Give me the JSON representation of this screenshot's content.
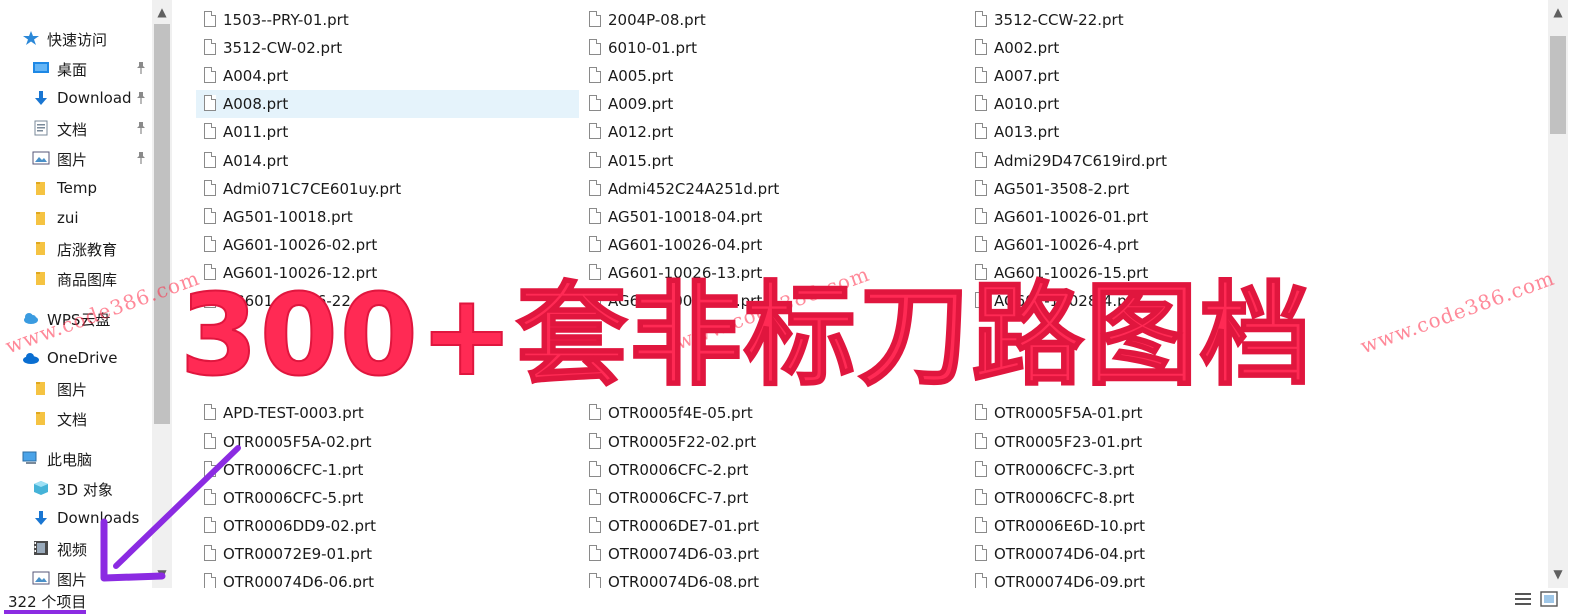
{
  "sidebar": {
    "items": [
      {
        "label": "快速访问",
        "icon": "star-icon",
        "pinned": false
      },
      {
        "label": "桌面",
        "icon": "desktop-icon",
        "pinned": true
      },
      {
        "label": "Download",
        "icon": "download-arrow-icon",
        "pinned": true
      },
      {
        "label": "文档",
        "icon": "document-icon",
        "pinned": true
      },
      {
        "label": "图片",
        "icon": "pictures-icon",
        "pinned": true
      },
      {
        "label": "Temp",
        "icon": "folder-icon",
        "pinned": false
      },
      {
        "label": "zui",
        "icon": "folder-icon",
        "pinned": false
      },
      {
        "label": "店涨教育",
        "icon": "folder-icon",
        "pinned": false
      },
      {
        "label": "商品图库",
        "icon": "folder-icon",
        "pinned": false
      },
      {
        "label": "WPS云盘",
        "icon": "cloud-icon",
        "pinned": false
      },
      {
        "label": "OneDrive",
        "icon": "onedrive-cloud-icon",
        "pinned": false
      },
      {
        "label": "图片",
        "icon": "folder-icon",
        "pinned": false
      },
      {
        "label": "文档",
        "icon": "folder-icon",
        "pinned": false
      },
      {
        "label": "此电脑",
        "icon": "computer-icon",
        "pinned": false
      },
      {
        "label": "3D 对象",
        "icon": "cube-3d-icon",
        "pinned": false
      },
      {
        "label": "Downloads",
        "icon": "download-arrow-icon",
        "pinned": false
      },
      {
        "label": "视频",
        "icon": "video-icon",
        "pinned": false
      },
      {
        "label": "图片",
        "icon": "pictures-icon",
        "pinned": false
      }
    ]
  },
  "files": [
    [
      "1503--PRY-01.prt",
      "2004P-08.prt",
      "3512-CCW-22.prt"
    ],
    [
      "3512-CW-02.prt",
      "6010-01.prt",
      "A002.prt"
    ],
    [
      "A004.prt",
      "A005.prt",
      "A007.prt"
    ],
    [
      "A008.prt",
      "A009.prt",
      "A010.prt"
    ],
    [
      "A011.prt",
      "A012.prt",
      "A013.prt"
    ],
    [
      "A014.prt",
      "A015.prt",
      "Admi29D47C619ird.prt"
    ],
    [
      "Admi071C7CE601uy.prt",
      "Admi452C24A251d.prt",
      "AG501-3508-2.prt"
    ],
    [
      "AG501-10018.prt",
      "AG501-10018-04.prt",
      "AG601-10026-01.prt"
    ],
    [
      "AG601-10026-02.prt",
      "AG601-10026-04.prt",
      "AG601-10026-4.prt"
    ],
    [
      "AG601-10026-12.prt",
      "AG601-10026-13.prt",
      "AG601-10026-15.prt"
    ],
    [
      "AG601-10026-22.prt",
      "AG601-10026-21.prt",
      "AG601-10028-4.prt"
    ],
    [
      "",
      "",
      ""
    ],
    [
      "",
      "",
      ""
    ],
    [
      "",
      "",
      ""
    ],
    [
      "APD-TEST-0003.prt",
      "OTR0005f4E-05.prt",
      "OTR0005F5A-01.prt"
    ],
    [
      "OTR0005F5A-02.prt",
      "OTR0005F22-02.prt",
      "OTR0005F23-01.prt"
    ],
    [
      "OTR0006CFC-1.prt",
      "OTR0006CFC-2.prt",
      "OTR0006CFC-3.prt"
    ],
    [
      "OTR0006CFC-5.prt",
      "OTR0006CFC-7.prt",
      "OTR0006CFC-8.prt"
    ],
    [
      "OTR0006DD9-02.prt",
      "OTR0006DE7-01.prt",
      "OTR0006E6D-10.prt"
    ],
    [
      "OTR00072E9-01.prt",
      "OTR00074D6-03.prt",
      "OTR00074D6-04.prt"
    ],
    [
      "OTR00074D6-06.prt",
      "OTR00074D6-08.prt",
      "OTR00074D6-09.prt"
    ]
  ],
  "selected_file": "A008.prt",
  "status": {
    "item_count": "322 个项目"
  },
  "overlay": {
    "headline": "300+套非标刀路图档",
    "watermark": "www.code386.com"
  },
  "colors": {
    "headline": "#ff2a54",
    "selection": "#e5f3fb",
    "underline": "#8b2be2",
    "arrow": "#8b2be2"
  }
}
